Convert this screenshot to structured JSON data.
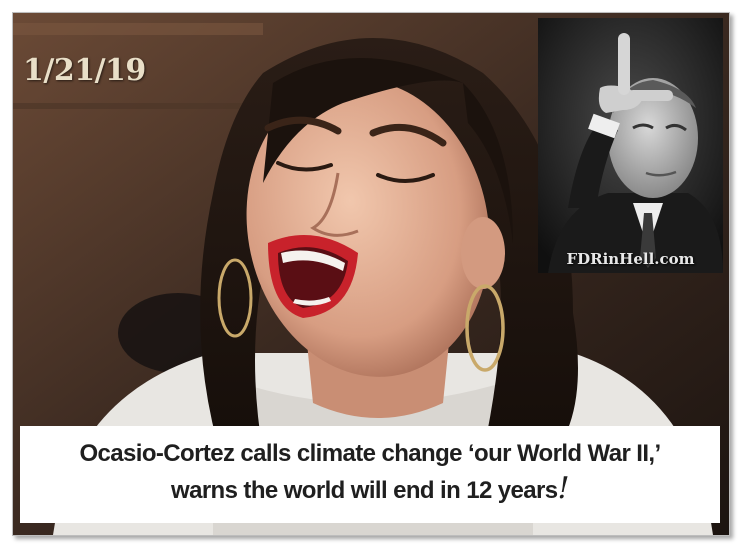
{
  "image": {
    "date_stamp": "1/21/19",
    "watermark": "FDRinHell.com",
    "headline_line1": "Ocasio-Cortez calls climate change ‘our World War II,’",
    "headline_line2": "warns the world will end in 12 years",
    "exclamation": "!"
  },
  "colors": {
    "caption_background": "#ffffff",
    "caption_text": "#1f1f1f",
    "date_stamp": "#e9dfc8"
  }
}
